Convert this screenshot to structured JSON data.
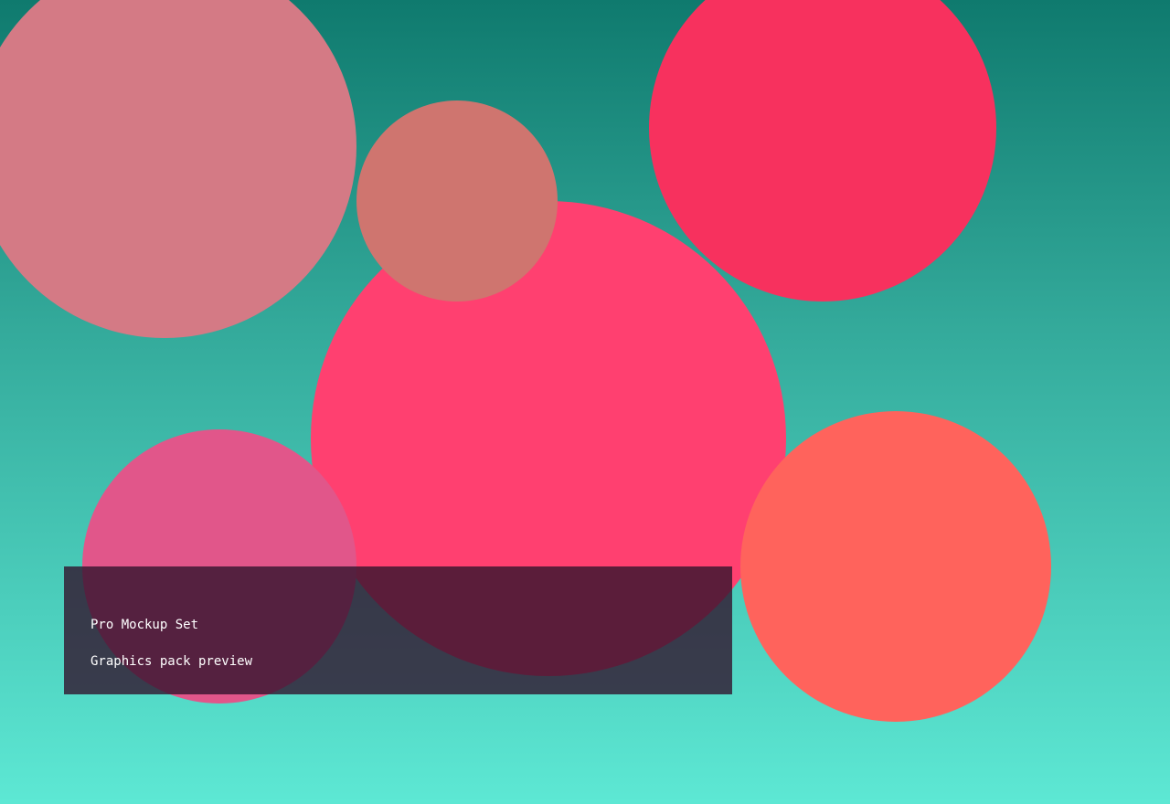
{
  "caption": {
    "title": "Pro Mockup Set",
    "subtitle": "Graphics pack preview"
  },
  "colors": {
    "background_top": "#0f7a6e",
    "background_bottom": "#5de8d4",
    "circle_top_left": "#d47a85",
    "circle_top_right": "#f7315e",
    "circle_center": "#ff4070",
    "circle_small": "#cf756f",
    "circle_bottom_left": "#e1568a",
    "circle_bottom_right": "#ff635c",
    "caption_panel": "#32142d"
  }
}
